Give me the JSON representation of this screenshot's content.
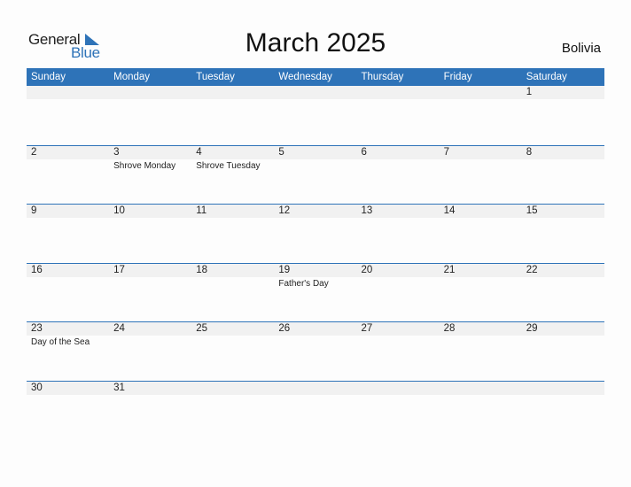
{
  "logo": {
    "part1": "General",
    "part2": "Blue"
  },
  "header": {
    "title": "March 2025",
    "country": "Bolivia"
  },
  "weekdays": [
    "Sunday",
    "Monday",
    "Tuesday",
    "Wednesday",
    "Thursday",
    "Friday",
    "Saturday"
  ],
  "colors": {
    "accent": "#2e73b8",
    "band": "#f1f1f1"
  },
  "weeks": [
    [
      {
        "d": ""
      },
      {
        "d": ""
      },
      {
        "d": ""
      },
      {
        "d": ""
      },
      {
        "d": ""
      },
      {
        "d": ""
      },
      {
        "d": "1"
      }
    ],
    [
      {
        "d": "2"
      },
      {
        "d": "3",
        "h": "Shrove Monday"
      },
      {
        "d": "4",
        "h": "Shrove Tuesday"
      },
      {
        "d": "5"
      },
      {
        "d": "6"
      },
      {
        "d": "7"
      },
      {
        "d": "8"
      }
    ],
    [
      {
        "d": "9"
      },
      {
        "d": "10"
      },
      {
        "d": "11"
      },
      {
        "d": "12"
      },
      {
        "d": "13"
      },
      {
        "d": "14"
      },
      {
        "d": "15"
      }
    ],
    [
      {
        "d": "16"
      },
      {
        "d": "17"
      },
      {
        "d": "18"
      },
      {
        "d": "19",
        "h": "Father's Day"
      },
      {
        "d": "20"
      },
      {
        "d": "21"
      },
      {
        "d": "22"
      }
    ],
    [
      {
        "d": "23",
        "h": "Day of the Sea"
      },
      {
        "d": "24"
      },
      {
        "d": "25"
      },
      {
        "d": "26"
      },
      {
        "d": "27"
      },
      {
        "d": "28"
      },
      {
        "d": "29"
      }
    ],
    [
      {
        "d": "30"
      },
      {
        "d": "31"
      },
      {
        "d": ""
      },
      {
        "d": ""
      },
      {
        "d": ""
      },
      {
        "d": ""
      },
      {
        "d": ""
      }
    ]
  ]
}
